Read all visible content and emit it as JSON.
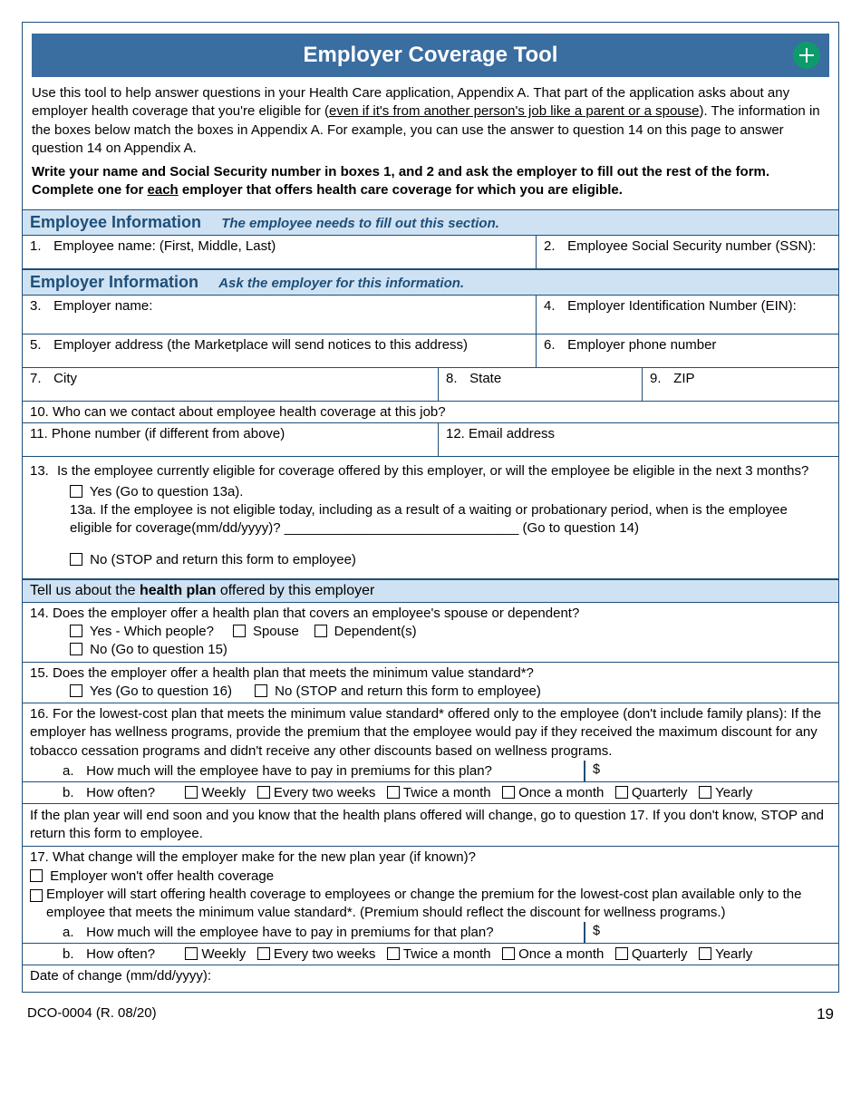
{
  "header": {
    "title": "Employer Coverage Tool"
  },
  "intro": {
    "line1a": "Use this tool to help answer questions in your Health Care application, Appendix A. That part of the application asks about any employer health coverage that you're eligible for (",
    "line1u": "even if it's from another person's job like a parent or a spouse",
    "line1b": "). The information in the boxes below match the boxes in Appendix A. For example, you can use the answer to question 14 on this page to answer question 14 on Appendix A.",
    "line2a": "Write your name and Social Security number in boxes 1, and 2 and ask the employer to fill out the rest of the form. Complete one for ",
    "line2u": "each",
    "line2b": " employer that offers health care coverage for which you are eligible."
  },
  "employee": {
    "head_title": "Employee Information",
    "head_sub": "The employee needs to fill out this section.",
    "q1_num": "1.",
    "q1": "Employee name: (First, Middle, Last)",
    "q2_num": "2.",
    "q2": "Employee Social Security number (SSN):"
  },
  "employer": {
    "head_title": "Employer Information",
    "head_sub": "Ask the employer for this information.",
    "q3_num": "3.",
    "q3": "Employer name:",
    "q4_num": "4.",
    "q4": "Employer Identification Number (EIN):",
    "q5_num": "5.",
    "q5": "Employer address (the Marketplace will send notices to this address)",
    "q6_num": "6.",
    "q6": "Employer phone number",
    "q7_num": "7.",
    "q7": "City",
    "q8_num": "8.",
    "q8": "State",
    "q9_num": "9.",
    "q9": "ZIP",
    "q10": "10.  Who can we contact about employee health coverage at this job?",
    "q11": "11.  Phone number (if different from above)",
    "q12": "12.  Email address"
  },
  "q13": {
    "num": "13.",
    "text": "Is the employee currently eligible for coverage offered by this employer, or will the employee be eligible in the next 3 months?",
    "yes": "Yes (Go to question 13a).",
    "a": "13a. If the employee is not eligible today, including as a result of a waiting or probationary period, when is the employee eligible for coverage(mm/dd/yyyy)? _______________________________  (Go to question 14)",
    "no": "No (STOP and return this form to employee)"
  },
  "plan_head_a": "Tell us about the ",
  "plan_head_b": "health plan",
  "plan_head_c": " offered by this employer",
  "q14": {
    "text": "14.  Does the employer offer a health plan that covers an employee's spouse or dependent?",
    "yes": "Yes   -   Which people?",
    "spouse": "Spouse",
    "dep": "Dependent(s)",
    "no": "No (Go to question 15)"
  },
  "q15": {
    "text": "15.  Does the employer offer a health plan that meets the minimum value standard*?",
    "yes": "Yes (Go to question 16)",
    "no": "No (STOP and return this form to employee)"
  },
  "q16": {
    "text": "16.  For the lowest-cost plan that meets the minimum value standard* offered only to the employee (don't include family plans): If the employer has wellness programs, provide the premium that the employee would pay if they received the maximum discount for any tobacco cessation programs and didn't receive any other discounts based on wellness programs.",
    "a_num": "a.",
    "a": "How much will the employee have to pay in premiums for this plan?",
    "dollar": "$",
    "b_num": "b.",
    "b": "How often?"
  },
  "freq": {
    "weekly": "Weekly",
    "biweekly": "Every two weeks",
    "twice": "Twice a month",
    "once": "Once a month",
    "quarterly": "Quarterly",
    "yearly": "Yearly"
  },
  "between": "If the plan year will end soon and you know that the health plans offered will change, go to question 17. If you don't know, STOP and return this form to employee.",
  "q17": {
    "text": "17.  What change will the employer make for the new plan year (if known)?",
    "opt1": "Employer won't offer health coverage",
    "opt2": "Employer will start offering health coverage to employees or change the premium for the lowest-cost plan available only to the employee that meets the minimum value standard*. (Premium should reflect the discount for wellness programs.)",
    "a_num": "a.",
    "a": "How much will the employee have to pay in premiums for that plan?",
    "dollar": "$",
    "b_num": "b.",
    "b": "How often?",
    "date": "Date of change (mm/dd/yyyy):"
  },
  "footer": {
    "code": "DCO-0004 (R. 08/20)",
    "page": "19"
  }
}
